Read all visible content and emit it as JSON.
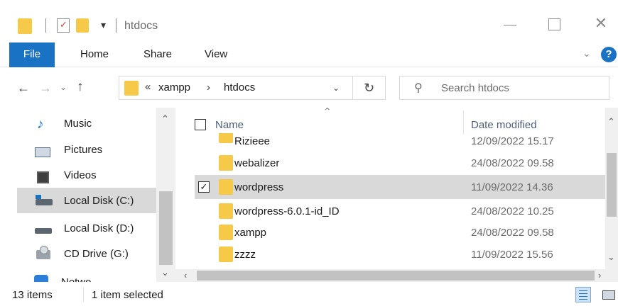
{
  "window": {
    "title": "htdocs",
    "quick_access_dropdown": "▾",
    "close_glyph": "✕"
  },
  "ribbon": {
    "tabs": [
      "File",
      "Home",
      "Share",
      "View"
    ],
    "help": "?",
    "expand": "⌄"
  },
  "navigation": {
    "back": "←",
    "forward": "→",
    "recent": "⌄",
    "up": "↑"
  },
  "address": {
    "overflow": "«",
    "segments": [
      "xampp",
      "htdocs"
    ],
    "separator": "›",
    "dropdown": "⌄",
    "refresh": "↻"
  },
  "search": {
    "placeholder": "Search htdocs",
    "icon": "search-icon"
  },
  "nav_pane": {
    "items": [
      {
        "label": "Music",
        "icon": "music-icon"
      },
      {
        "label": "Pictures",
        "icon": "pictures-icon"
      },
      {
        "label": "Videos",
        "icon": "videos-icon"
      },
      {
        "label": "Local Disk (C:)",
        "icon": "drive-c-icon",
        "selected": true
      },
      {
        "label": "Local Disk (D:)",
        "icon": "drive-d-icon"
      },
      {
        "label": "CD Drive (G:)",
        "icon": "cd-drive-icon"
      }
    ],
    "partial_label": "Network"
  },
  "file_list": {
    "columns": {
      "name": "Name",
      "date": "Date modified"
    },
    "rows": [
      {
        "name": "Rizieee",
        "date": "12/09/2022 15.17",
        "selected": false
      },
      {
        "name": "webalizer",
        "date": "24/08/2022 09.58",
        "selected": false
      },
      {
        "name": "wordpress",
        "date": "11/09/2022 14.36",
        "selected": true
      },
      {
        "name": "wordpress-6.0.1-id_ID",
        "date": "24/08/2022 10.25",
        "selected": false
      },
      {
        "name": "xampp",
        "date": "24/08/2022 09.58",
        "selected": false
      },
      {
        "name": "zzzz",
        "date": "11/09/2022 15.56",
        "selected": false
      }
    ]
  },
  "status": {
    "count": "13 items",
    "selection": "1 item selected"
  },
  "colors": {
    "accent": "#1a72c4",
    "folder": "#f7c948",
    "selection": "#d9d9d9"
  }
}
